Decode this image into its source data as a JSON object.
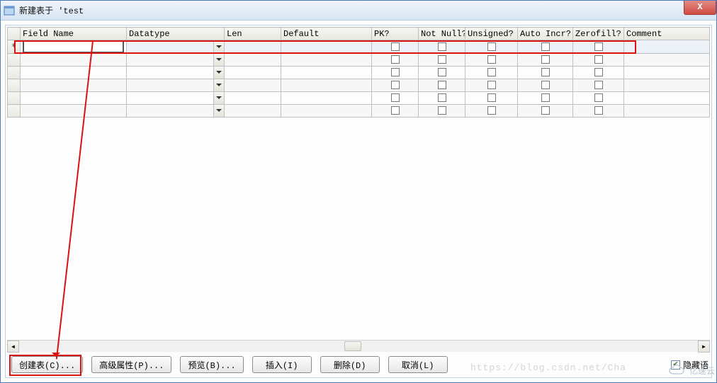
{
  "window": {
    "title": "新建表于 'test"
  },
  "columns": {
    "field_name": "Field Name",
    "datatype": "Datatype",
    "len": "Len",
    "default": "Default",
    "pk": "PK?",
    "not_null": "Not Null?",
    "unsigned": "Unsigned?",
    "auto_incr": "Auto Incr?",
    "zerofill": "Zerofill?",
    "comment": "Comment"
  },
  "rows": [
    {
      "marker": "*",
      "selected": true,
      "field": "",
      "datatype": ""
    },
    {
      "marker": "",
      "selected": false,
      "field": "",
      "datatype": ""
    },
    {
      "marker": "",
      "selected": false,
      "field": "",
      "datatype": ""
    },
    {
      "marker": "",
      "selected": false,
      "field": "",
      "datatype": ""
    },
    {
      "marker": "",
      "selected": false,
      "field": "",
      "datatype": ""
    },
    {
      "marker": "",
      "selected": false,
      "field": "",
      "datatype": ""
    }
  ],
  "buttons": {
    "create": "创建表(C)...",
    "advanced": "高级属性(P)...",
    "preview": "预览(B)...",
    "insert": "插入(I)",
    "delete": "删除(D)",
    "cancel": "取消(L)"
  },
  "hide_lang": {
    "checked": true,
    "label": "隐藏语"
  },
  "watermark": {
    "url": "https://blog.csdn.net/Cha",
    "brand": "亿速云"
  }
}
